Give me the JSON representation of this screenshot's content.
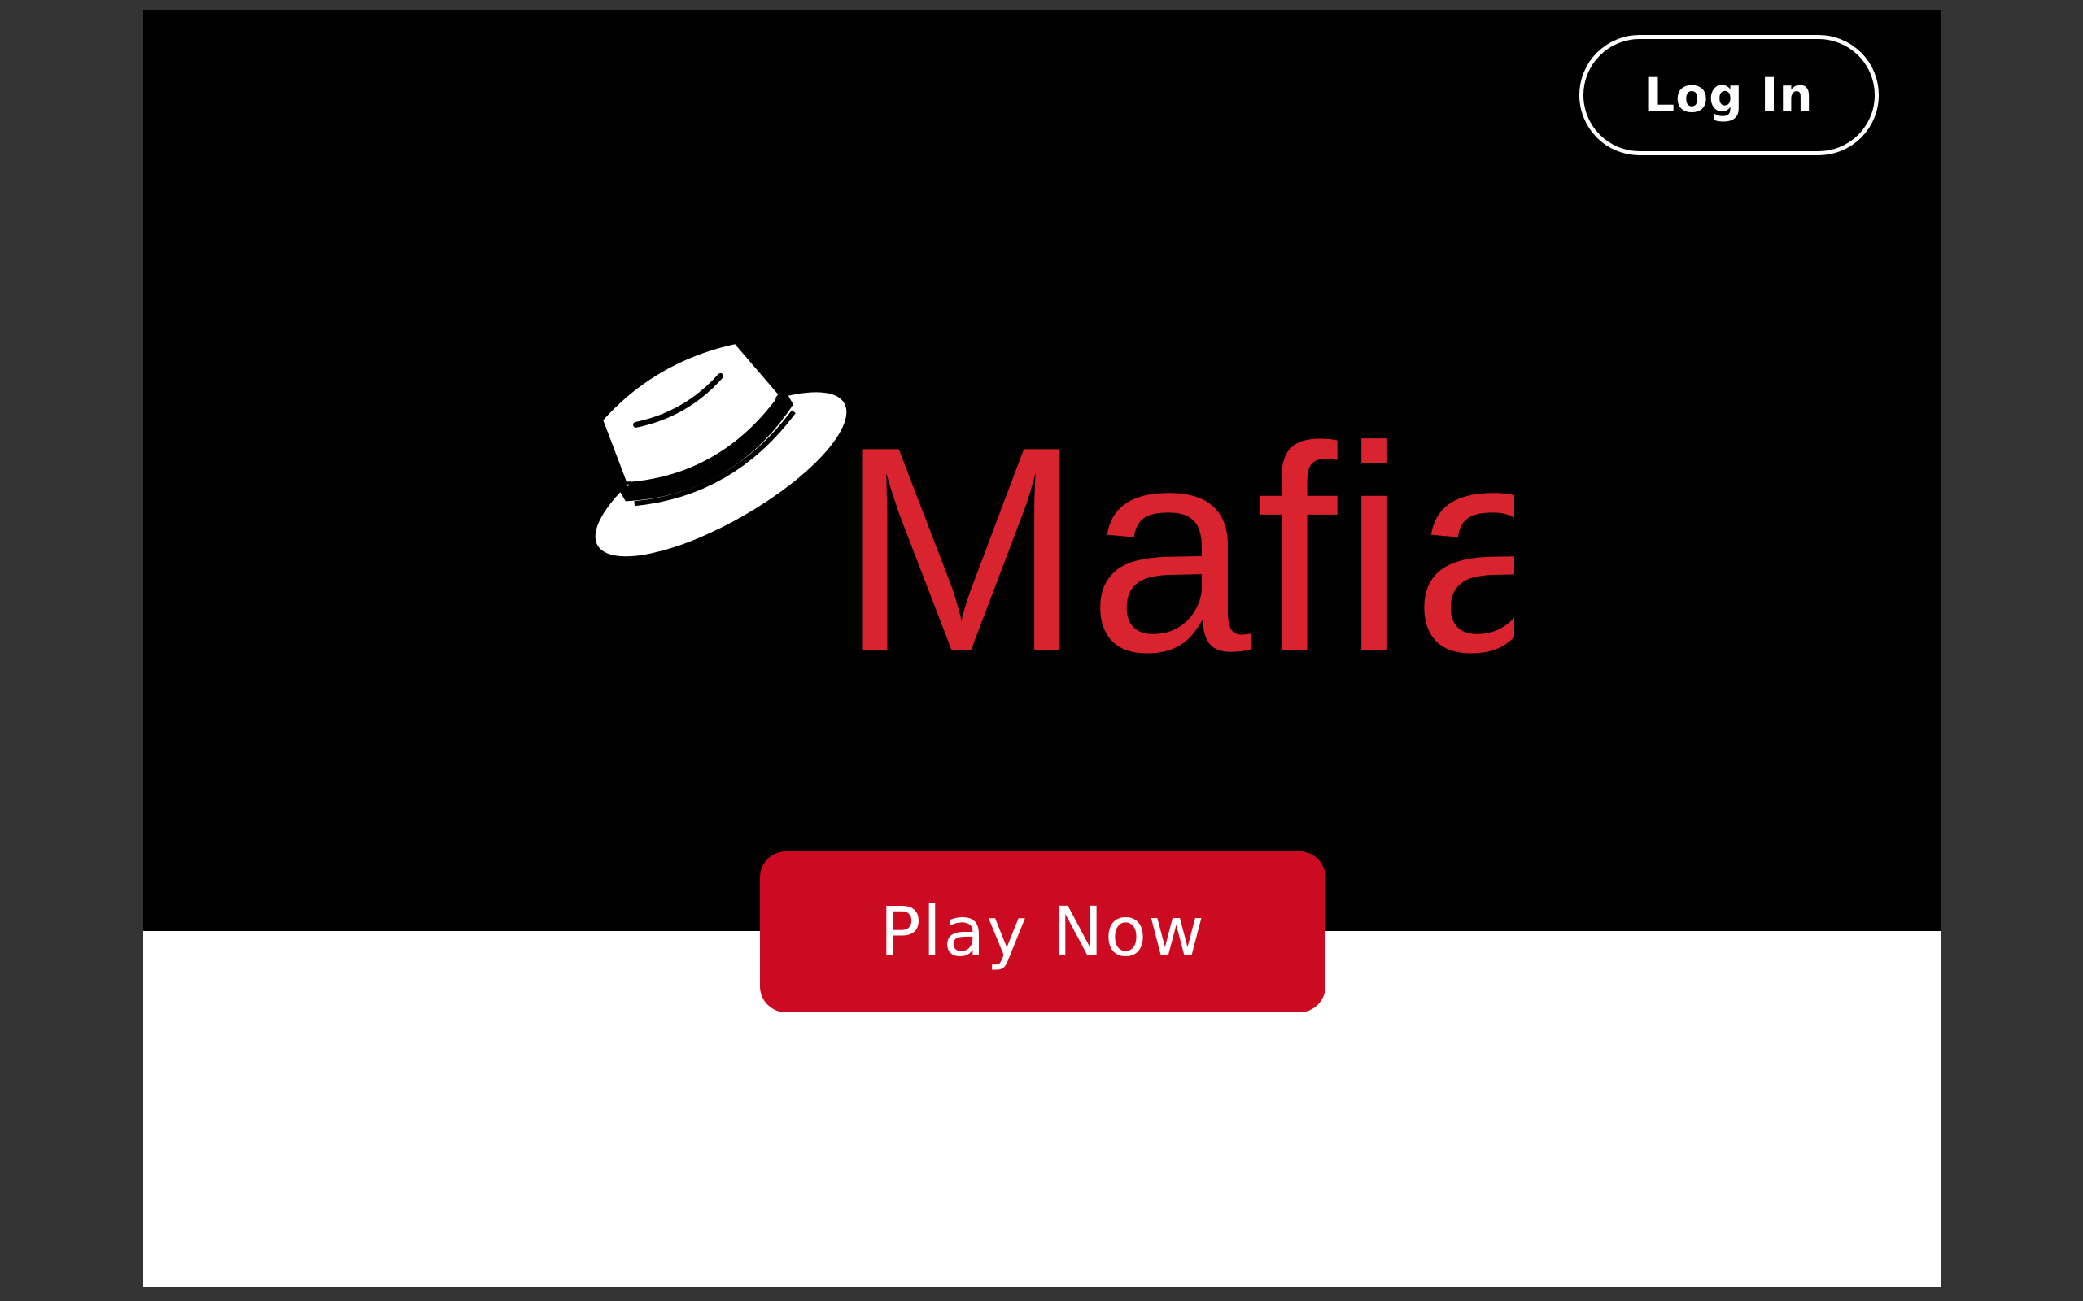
{
  "header": {
    "login_label": "Log In"
  },
  "logo": {
    "brand_name": "Mafia",
    "icon": "fedora-hat-icon",
    "brand_color": "#d9232e"
  },
  "hero": {
    "play_label": "Play Now",
    "play_color": "#cc0a22"
  },
  "colors": {
    "hero_background": "#000000",
    "page_background": "#ffffff",
    "canvas_background": "#333333"
  }
}
